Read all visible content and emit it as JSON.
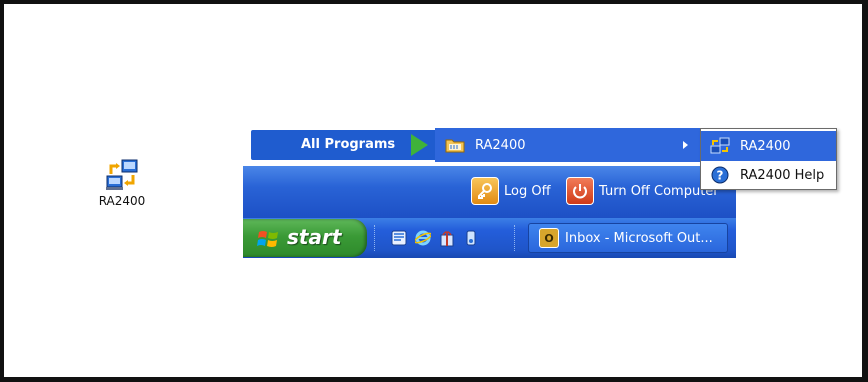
{
  "desktop": {
    "icon_label": "RA2400"
  },
  "start_menu": {
    "all_programs_label": "All Programs",
    "log_off_label": "Log Off",
    "turn_off_label": "Turn Off Computer"
  },
  "programs_submenu": {
    "folder_label": "RA2400"
  },
  "folder_submenu": {
    "items": [
      {
        "label": "RA2400",
        "icon": "ra2400-app-icon"
      },
      {
        "label": "RA2400 Help",
        "icon": "help-icon"
      }
    ]
  },
  "taskbar": {
    "start_label": "start",
    "task_button_label": "Inbox - Microsoft Out...",
    "quick_launch": [
      "outlook-express-icon",
      "internet-explorer-icon",
      "gift-icon",
      "media-icon"
    ]
  },
  "colors": {
    "taskbar_blue": "#245edb",
    "start_green": "#3a9a36",
    "highlight_blue": "#2f67dc"
  }
}
